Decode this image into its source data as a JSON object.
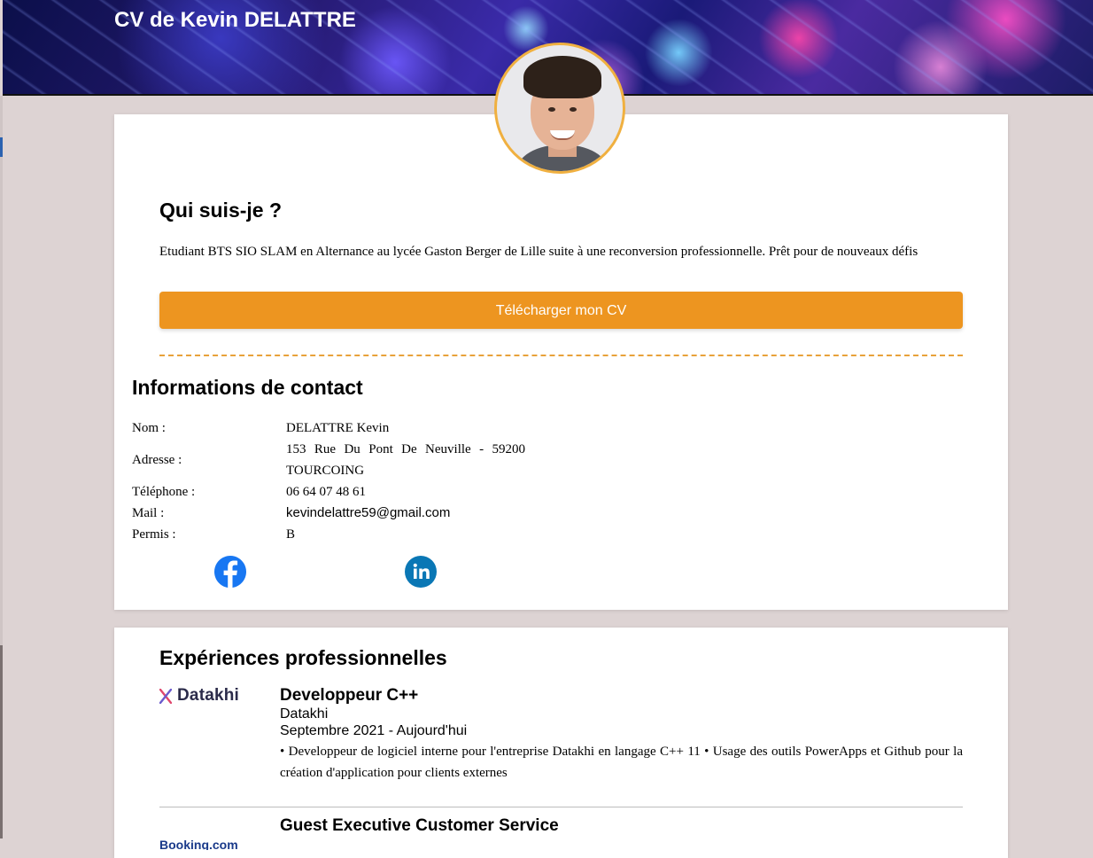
{
  "header": {
    "title": "CV de Kevin DELATTRE"
  },
  "about": {
    "heading": "Qui suis-je ?",
    "text": "Etudiant BTS SIO SLAM en Alternance au lycée Gaston Berger de Lille suite à une reconversion professionnelle. Prêt pour de nouveaux défis",
    "download_label": "Télécharger mon CV"
  },
  "contact": {
    "heading": "Informations de contact",
    "rows": [
      {
        "label": "Nom :",
        "value": "DELATTRE Kevin"
      },
      {
        "label": "Adresse :",
        "value": "153 Rue Du Pont De Neuville - 59200 TOURCOING"
      },
      {
        "label": "Téléphone :",
        "value": "06 64 07 48 61"
      },
      {
        "label": "Mail :",
        "value": "kevindelattre59@gmail.com"
      },
      {
        "label": "Permis :",
        "value": "B"
      }
    ],
    "social": [
      {
        "icon": "facebook-icon",
        "color": "#1877f2"
      },
      {
        "icon": "linkedin-icon",
        "color": "#0a77b5"
      }
    ]
  },
  "experiences": {
    "heading": "Expériences professionnelles",
    "items": [
      {
        "logo_text": "Datakhi",
        "title": "Developpeur C++",
        "company": "Datakhi",
        "dates": "Septembre 2021 - Aujourd'hui",
        "description": "• Developpeur de logiciel interne pour l'entreprise Datakhi en langage C++ 11 • Usage des outils PowerApps et Github pour la création d'application pour clients externes"
      },
      {
        "logo_text": "Booking.com",
        "title": "Guest Executive Customer Service"
      }
    ]
  },
  "colors": {
    "accent": "#ed9520",
    "page_bg": "#ddd3d3",
    "header_bg": "#0a0c3a"
  }
}
